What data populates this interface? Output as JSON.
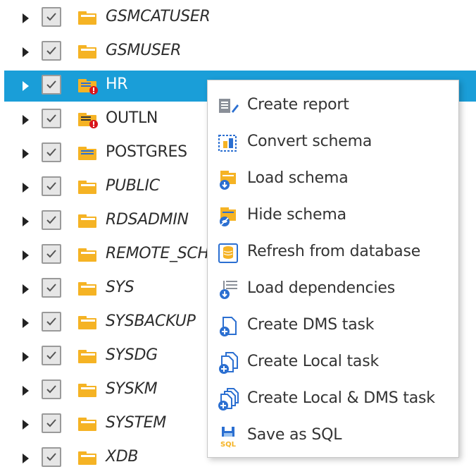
{
  "tree": {
    "items": [
      {
        "label": "GSMCATUSER",
        "italic": true,
        "icon": "folder-icon"
      },
      {
        "label": "GSMUSER",
        "italic": true,
        "icon": "folder-icon"
      },
      {
        "label": "HR",
        "italic": false,
        "icon": "schema-warning-icon",
        "selected": true
      },
      {
        "label": "OUTLN",
        "italic": false,
        "icon": "schema-warning-icon"
      },
      {
        "label": "POSTGRES",
        "italic": false,
        "icon": "schema-icon"
      },
      {
        "label": "PUBLIC",
        "italic": true,
        "icon": "folder-icon"
      },
      {
        "label": "RDSADMIN",
        "italic": true,
        "icon": "folder-icon"
      },
      {
        "label": "REMOTE_SCH",
        "italic": true,
        "icon": "folder-icon"
      },
      {
        "label": "SYS",
        "italic": true,
        "icon": "folder-icon"
      },
      {
        "label": "SYSBACKUP",
        "italic": true,
        "icon": "folder-icon"
      },
      {
        "label": "SYSDG",
        "italic": true,
        "icon": "folder-icon"
      },
      {
        "label": "SYSKM",
        "italic": true,
        "icon": "folder-icon"
      },
      {
        "label": "SYSTEM",
        "italic": true,
        "icon": "folder-icon"
      },
      {
        "label": "XDB",
        "italic": true,
        "icon": "folder-icon"
      }
    ]
  },
  "context_menu": {
    "items": [
      {
        "label": "Create report",
        "icon": "report-icon"
      },
      {
        "label": "Convert schema",
        "icon": "convert-icon"
      },
      {
        "label": "Load schema",
        "icon": "load-schema-icon"
      },
      {
        "label": "Hide schema",
        "icon": "hide-schema-icon"
      },
      {
        "label": "Refresh from database",
        "icon": "refresh-database-icon"
      },
      {
        "label": "Load dependencies",
        "icon": "load-dependencies-icon"
      },
      {
        "label": "Create DMS task",
        "icon": "create-task-icon"
      },
      {
        "label": "Create Local task",
        "icon": "create-local-task-icon"
      },
      {
        "label": "Create Local & DMS task",
        "icon": "create-local-dms-task-icon"
      },
      {
        "label": "Save as SQL",
        "icon": "save-sql-icon"
      }
    ]
  },
  "colors": {
    "selection": "#1a9ed8",
    "folder": "#f5b324",
    "warning": "#d9141b",
    "accent_blue": "#2b6fd1"
  }
}
